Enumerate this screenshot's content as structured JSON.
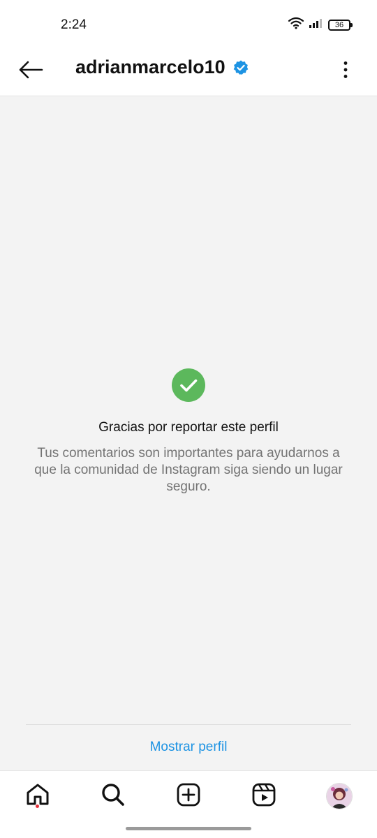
{
  "status_bar": {
    "time": "2:24",
    "battery": "36"
  },
  "header": {
    "username": "adrianmarcelo10",
    "verified_color": "#1d93e3"
  },
  "report_confirmation": {
    "icon": "check-circle-icon",
    "icon_color": "#5cb85c",
    "title": "Gracias por reportar este perfil",
    "description": "Tus comentarios son importantes para ayudarnos a que la comunidad de Instagram siga siendo un lugar seguro."
  },
  "actions": {
    "show_profile": "Mostrar perfil",
    "link_color": "#1d93e3"
  },
  "bottom_nav": {
    "items": [
      "home-icon",
      "search-icon",
      "create-icon",
      "reels-icon",
      "profile-avatar"
    ],
    "notification_dot_color": "#e5303a"
  }
}
